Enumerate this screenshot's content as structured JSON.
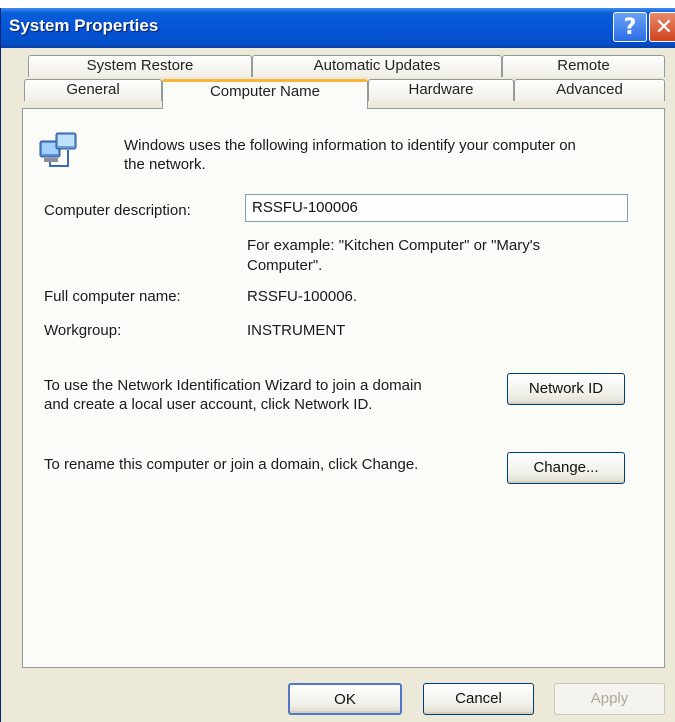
{
  "window": {
    "title": "System Properties"
  },
  "tabs": {
    "row1": [
      "System Restore",
      "Automatic Updates",
      "Remote"
    ],
    "row2": [
      "General",
      "Computer Name",
      "Hardware",
      "Advanced"
    ],
    "active": "Computer Name"
  },
  "computer_name": {
    "intro": "Windows uses the following information to identify your computer on",
    "intro_line2": "the network.",
    "description_label": "Computer description:",
    "description_value": "RSSFU-100006",
    "example_line1": "For example: \"Kitchen Computer\" or \"Mary's",
    "example_line2": "Computer\".",
    "full_name_label": "Full computer name:",
    "full_name_value": "RSSFU-100006.",
    "workgroup_label": "Workgroup:",
    "workgroup_value": "INSTRUMENT",
    "network_id_text1": "To use the Network Identification Wizard to join a domain",
    "network_id_text2": "and create a local user account, click Network ID.",
    "network_id_button": "Network ID",
    "rename_text": "To rename this computer or join a domain, click Change.",
    "change_button": "Change..."
  },
  "footer": {
    "ok": "OK",
    "cancel": "Cancel",
    "apply": "Apply"
  },
  "icons": {
    "help": "help-icon",
    "close": "close-icon",
    "computer": "network-computer-icon"
  }
}
